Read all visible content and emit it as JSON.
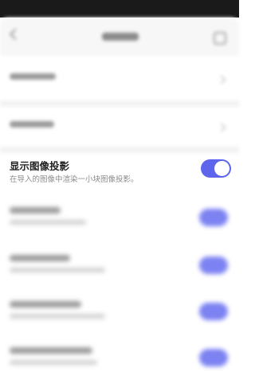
{
  "setting": {
    "title": "显示图像投影",
    "description": "在导入的图像中渲染一小块图像投影。",
    "enabled": true
  },
  "colors": {
    "accent": "#5e64ec",
    "status_bar": "#1a1a1a",
    "title_text": "#222222",
    "description_text": "#8c8c8c"
  },
  "icons": {
    "back": "chevron-left-icon",
    "more": "more-icon"
  }
}
